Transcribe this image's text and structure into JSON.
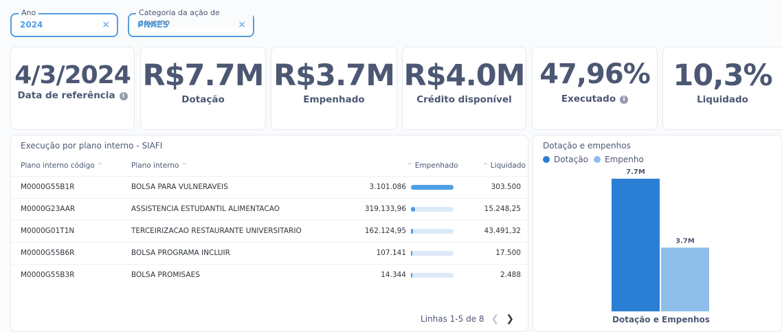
{
  "filters": [
    {
      "label": "Ano",
      "value": "2024",
      "clear": "×"
    },
    {
      "label": "Categoria da ação de governo",
      "value": "PNAES",
      "clear": "×"
    }
  ],
  "kpis": [
    {
      "value": "4/3/2024",
      "label": "Data de referência",
      "info": true
    },
    {
      "value": "R$7.7M",
      "label": "Dotação",
      "info": false
    },
    {
      "value": "R$3.7M",
      "label": "Empenhado",
      "info": false
    },
    {
      "value": "R$4.0M",
      "label": "Crédito disponível",
      "info": false
    },
    {
      "value": "47,96%",
      "label": "Executado",
      "info": true
    },
    {
      "value": "10,3%",
      "label": "Liquidado",
      "info": false
    }
  ],
  "table": {
    "title": "Execução por plano interno - SIAFI",
    "columns": {
      "codigo": "Plano interno código",
      "plano": "Plano interno",
      "empenhado": "Empenhado",
      "liquidado": "Liquidado"
    },
    "rows": [
      {
        "codigo": "M0000G55B1R",
        "plano": "BOLSA PARA VULNERAVEIS",
        "empenhado": "3.101.086",
        "empenhado_value": 3101086,
        "liquidado": "303.500"
      },
      {
        "codigo": "M0000G23AAR",
        "plano": "ASSISTENCIA ESTUDANTIL ALIMENTACAO",
        "empenhado": "319.133,96",
        "empenhado_value": 319133.96,
        "liquidado": "15.248,25"
      },
      {
        "codigo": "M0000G01T1N",
        "plano": "TERCEIRIZACAO RESTAURANTE UNIVERSITARIO",
        "empenhado": "162.124,95",
        "empenhado_value": 162124.95,
        "liquidado": "43.491,32"
      },
      {
        "codigo": "M0000G55B6R",
        "plano": "BOLSA PROGRAMA INCLUIR",
        "empenhado": "107.141",
        "empenhado_value": 107141,
        "liquidado": "17.500"
      },
      {
        "codigo": "M0000G55B3R",
        "plano": "BOLSA PROMISAES",
        "empenhado": "14.344",
        "empenhado_value": 14344,
        "liquidado": "2.488"
      }
    ],
    "pagination": "Linhas 1-5 de 8"
  },
  "chart_data": {
    "type": "bar",
    "title": "Dotação e empenhos",
    "xlabel": "Dotação e Empenhos",
    "categories": [
      "Dotação e Empenhos"
    ],
    "series": [
      {
        "name": "Dotação",
        "values": [
          7.7
        ],
        "label": "7.7M",
        "color": "#2a7fd4"
      },
      {
        "name": "Empenho",
        "values": [
          3.7
        ],
        "label": "3.7M",
        "color": "#8ebde9"
      }
    ],
    "ylim": [
      0,
      7.7
    ],
    "legend_position": "top-left",
    "grid": false
  },
  "colors": {
    "accent": "#509ee3",
    "text": "#4c5773",
    "dotacao": "#2a7fd4",
    "empenho": "#8ebde9"
  }
}
